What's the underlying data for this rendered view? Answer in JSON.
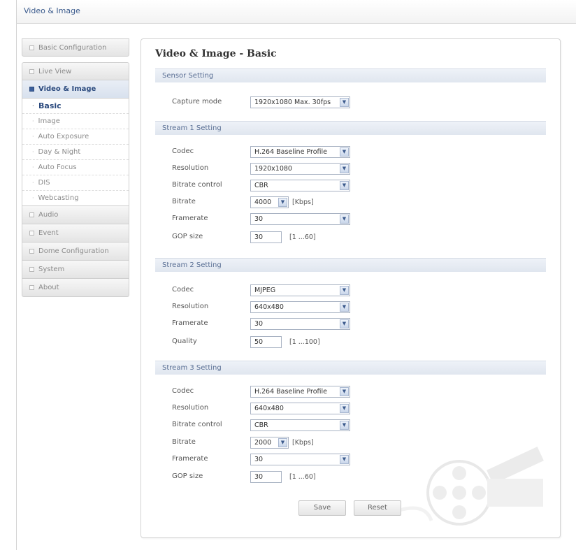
{
  "header": {
    "title": "Video & Image"
  },
  "sidebar": {
    "items": [
      {
        "label": "Basic Configuration"
      },
      {
        "label": "Live View"
      },
      {
        "label": "Video & Image"
      },
      {
        "label": "Audio"
      },
      {
        "label": "Event"
      },
      {
        "label": "Dome Configuration"
      },
      {
        "label": "System"
      },
      {
        "label": "About"
      }
    ],
    "submenu": [
      {
        "label": "Basic"
      },
      {
        "label": "Image"
      },
      {
        "label": "Auto Exposure"
      },
      {
        "label": "Day & Night"
      },
      {
        "label": "Auto Focus"
      },
      {
        "label": "DIS"
      },
      {
        "label": "Webcasting"
      }
    ]
  },
  "main": {
    "title": "Video & Image - Basic",
    "sensor": {
      "header": "Sensor Setting",
      "capture_mode": {
        "label": "Capture mode",
        "value": "1920x1080 Max. 30fps"
      }
    },
    "stream1": {
      "header": "Stream 1 Setting",
      "codec": {
        "label": "Codec",
        "value": "H.264 Baseline Profile"
      },
      "resolution": {
        "label": "Resolution",
        "value": "1920x1080"
      },
      "bitrate_control": {
        "label": "Bitrate control",
        "value": "CBR"
      },
      "bitrate": {
        "label": "Bitrate",
        "value": "4000",
        "unit": "[Kbps]"
      },
      "framerate": {
        "label": "Framerate",
        "value": "30"
      },
      "gop": {
        "label": "GOP size",
        "value": "30",
        "range": "[1 ...60]"
      }
    },
    "stream2": {
      "header": "Stream 2 Setting",
      "codec": {
        "label": "Codec",
        "value": "MJPEG"
      },
      "resolution": {
        "label": "Resolution",
        "value": "640x480"
      },
      "framerate": {
        "label": "Framerate",
        "value": "30"
      },
      "quality": {
        "label": "Quality",
        "value": "50",
        "range": "[1 ...100]"
      }
    },
    "stream3": {
      "header": "Stream 3 Setting",
      "codec": {
        "label": "Codec",
        "value": "H.264 Baseline Profile"
      },
      "resolution": {
        "label": "Resolution",
        "value": "640x480"
      },
      "bitrate_control": {
        "label": "Bitrate control",
        "value": "CBR"
      },
      "bitrate": {
        "label": "Bitrate",
        "value": "2000",
        "unit": "[Kbps]"
      },
      "framerate": {
        "label": "Framerate",
        "value": "30"
      },
      "gop": {
        "label": "GOP size",
        "value": "30",
        "range": "[1 ...60]"
      }
    },
    "buttons": {
      "save": "Save",
      "reset": "Reset"
    }
  },
  "colors": {
    "accent": "#2b4a7e",
    "section": "#e0e6ef"
  }
}
